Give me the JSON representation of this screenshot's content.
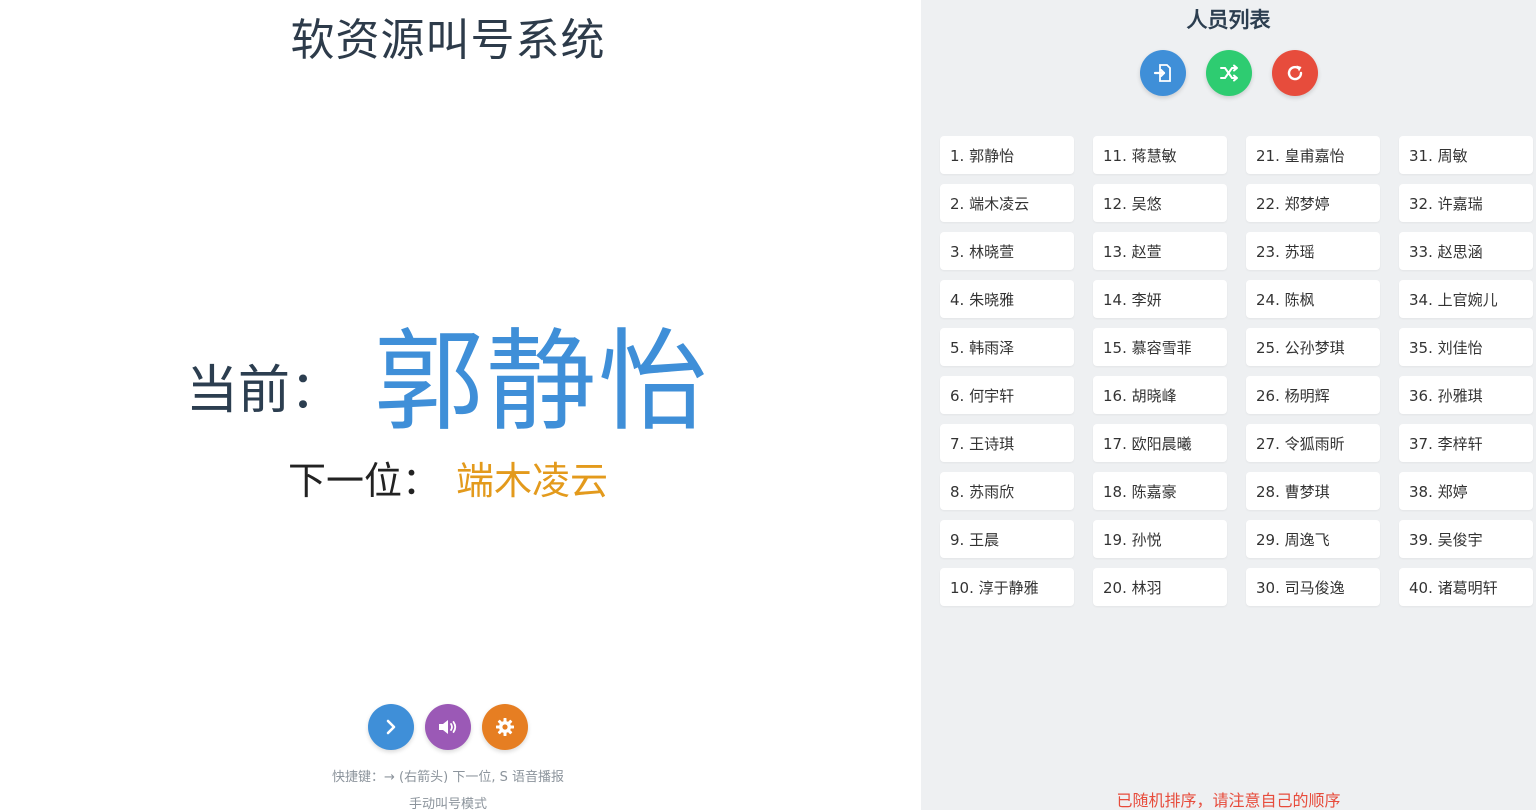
{
  "left": {
    "title": "软资源叫号系统",
    "current_label": "当前：",
    "current_name": "郭静怡",
    "next_label": "下一位：",
    "next_name": "端木凌云",
    "controls": [
      {
        "icon": "chevron-right-icon",
        "color": "#3f8fd8"
      },
      {
        "icon": "speaker-icon",
        "color": "#9b59b6"
      },
      {
        "icon": "gear-icon",
        "color": "#e67e22"
      }
    ],
    "hint": "快捷键：→ (右箭头) 下一位, S 语音播报",
    "mode": "手动叫号模式"
  },
  "right": {
    "title": "人员列表",
    "controls": [
      {
        "icon": "import-icon",
        "color": "#3f8fd8"
      },
      {
        "icon": "shuffle-icon",
        "color": "#2ecc71"
      },
      {
        "icon": "refresh-icon",
        "color": "#e74c3c"
      }
    ],
    "people": [
      "1. 郭静怡",
      "2. 端木凌云",
      "3. 林晓萱",
      "4. 朱晓雅",
      "5. 韩雨泽",
      "6. 何宇轩",
      "7. 王诗琪",
      "8. 苏雨欣",
      "9. 王晨",
      "10. 淳于静雅",
      "11. 蒋慧敏",
      "12. 吴悠",
      "13. 赵萱",
      "14. 李妍",
      "15. 慕容雪菲",
      "16. 胡晓峰",
      "17. 欧阳晨曦",
      "18. 陈嘉豪",
      "19. 孙悦",
      "20. 林羽",
      "21. 皇甫嘉怡",
      "22. 郑梦婷",
      "23. 苏瑶",
      "24. 陈枫",
      "25. 公孙梦琪",
      "26. 杨明辉",
      "27. 令狐雨昕",
      "28. 曹梦琪",
      "29. 周逸飞",
      "30. 司马俊逸",
      "31. 周敏",
      "32. 许嘉瑞",
      "33. 赵思涵",
      "34. 上官婉儿",
      "35. 刘佳怡",
      "36. 孙雅琪",
      "37. 李梓轩",
      "38. 郑婷",
      "39. 吴俊宇",
      "40. 诸葛明轩"
    ],
    "notice": "已随机排序，请注意自己的顺序"
  }
}
